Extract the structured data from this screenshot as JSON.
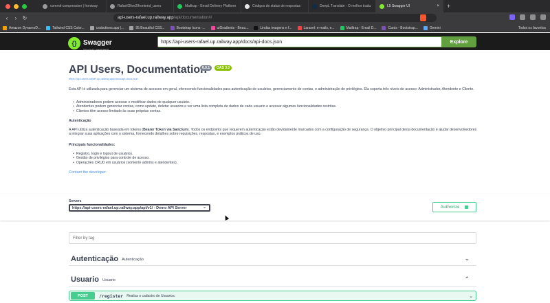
{
  "browser": {
    "tabs": [
      {
        "label": "commit-compression | frontway",
        "active": false
      },
      {
        "label": "RafaelOlive2/frontend_users",
        "active": false
      },
      {
        "label": "Mailtrap - Email Delivery Platform",
        "active": false
      },
      {
        "label": "Códigos de status de respostas",
        "active": false
      },
      {
        "label": "DeepL Translate - O melhor tradu",
        "active": false
      },
      {
        "label": "L5 Swagger UI",
        "active": true
      }
    ],
    "url_host": "api-users-rafael.up.railway.app",
    "url_path": "/api/documentation#/",
    "bookmarks": [
      "Amazon DynamoD...",
      "Tailwind CSS Color...",
      "cssbuttons.app |...",
      "95 Beautiful CSS...",
      "Bootstrap Icons ·...",
      "uiGradients - Beau...",
      "Lindas imagens e f...",
      "Laravel: e-mails, e...",
      "Mailtrap - Email D...",
      "Cards - Bootstrap...",
      "Gemini"
    ],
    "bookmarks_right": "Todos os favoritos"
  },
  "swagger": {
    "logo_text": "Swagger",
    "logo_sub": "Supported by SMARTBEAR",
    "spec_url": "https://api-users-rafael.up.railway.app/docs/api-docs.json",
    "explore_label": "Explore"
  },
  "info": {
    "title": "API Users, Documentation",
    "version": "0.0.1",
    "oas": "OAS 3.0",
    "doc_link": "https://api-users-rafael.up.railway.app/docs/api-docs.json",
    "intro": "Esta API é utilizada para gerenciar um sistema de acessos em geral, oferecendo funcionalidades para autenticação de usuários, gerenciamento de contas, e administração de privilégios. Ela suporta três níveis de acesso: Administrador, Atendente e Cliente.",
    "roles": [
      "Administradores podem acessar e modificar dados de qualquer usuário.",
      "Atendentes podem gerenciar contas, como update, deletar usuarios e ver uma lista completa de dados de cada usuario e acessar algumas funcionalidades restritas.",
      "Clientes têm acesso limitado às suas próprias contas."
    ],
    "auth_heading": "Autenticação",
    "auth_text_pre": "A API utiliza autenticação baseada em tokens (",
    "auth_text_bold": "Bearer Token via Sanctum",
    "auth_text_post": "). Todos os endpoints que requerem autenticação estão devidamente marcados com a configuração de segurança. O objetivo principal desta documentação é ajudar desenvolvedores a integrar suas aplicações com o sistema, fornecendo detalhes sobre requisições, respostas, e exemplos práticos de uso.",
    "features_heading": "Principais funcionalidades:",
    "features": [
      "Registro, login e logout de usuários.",
      "Gestão de privilégios para controle de acesso.",
      "Operações CRUD em usuários (somente admins e atendentes)."
    ],
    "contact": "Contact the developer"
  },
  "servers": {
    "label": "Servers",
    "selected": "https://api-users-rafael.up.railway.app/api/v1/ - Demo API Server",
    "authorize_label": "Authorize"
  },
  "filter": {
    "placeholder": "Filter by tag"
  },
  "tags": [
    {
      "name": "Autenticação",
      "description": "Autenticação",
      "expanded": false
    },
    {
      "name": "Usuario",
      "description": "Usuario",
      "expanded": true
    }
  ],
  "operation": {
    "method": "POST",
    "path": "/register",
    "summary": "Realiza o cadastro de Usuarios."
  },
  "colors": {
    "post": "#49cc90",
    "explore": "#62a03f",
    "logo": "#85ea2d",
    "link": "#4990e2"
  }
}
